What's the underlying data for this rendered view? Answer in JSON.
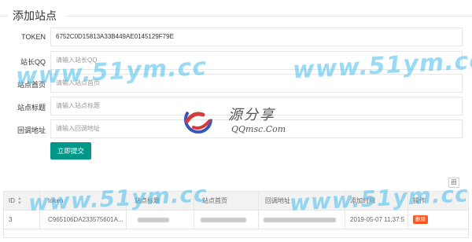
{
  "form": {
    "title": "添加站点",
    "fields": [
      {
        "label": "TOKEN",
        "value": "6752C0D15813A33B449AE0145129F79E",
        "placeholder": ""
      },
      {
        "label": "站长QQ",
        "value": "",
        "placeholder": "请输入站长QQ"
      },
      {
        "label": "站点首页",
        "value": "",
        "placeholder": "请输入站点首页"
      },
      {
        "label": "站点标题",
        "value": "",
        "placeholder": "请输入站点标题"
      },
      {
        "label": "回调地址",
        "value": "",
        "placeholder": "请输入回调地址"
      }
    ],
    "submit_label": "立即提交"
  },
  "toolbar": {
    "icon": "columns-icon",
    "glyph": "田"
  },
  "table": {
    "headers": [
      "ID",
      "token",
      "站点标题",
      "站点首页",
      "回调地址",
      "添加时间",
      "操作"
    ],
    "rows": [
      {
        "id": "3",
        "token": "C965106DA233575601A...",
        "time": "2019-05-07 11:37:5",
        "action": "删除"
      }
    ]
  },
  "watermarks": [
    "www.51ym.cc",
    "www.51ym.cc",
    "www.51ym.cc",
    "www.51ym.cc"
  ],
  "logo": {
    "cn": "源分享",
    "en": "QQmsc.Com"
  },
  "colors": {
    "primary": "#009688",
    "danger": "#ff5722",
    "watermark": "#46beeb"
  }
}
